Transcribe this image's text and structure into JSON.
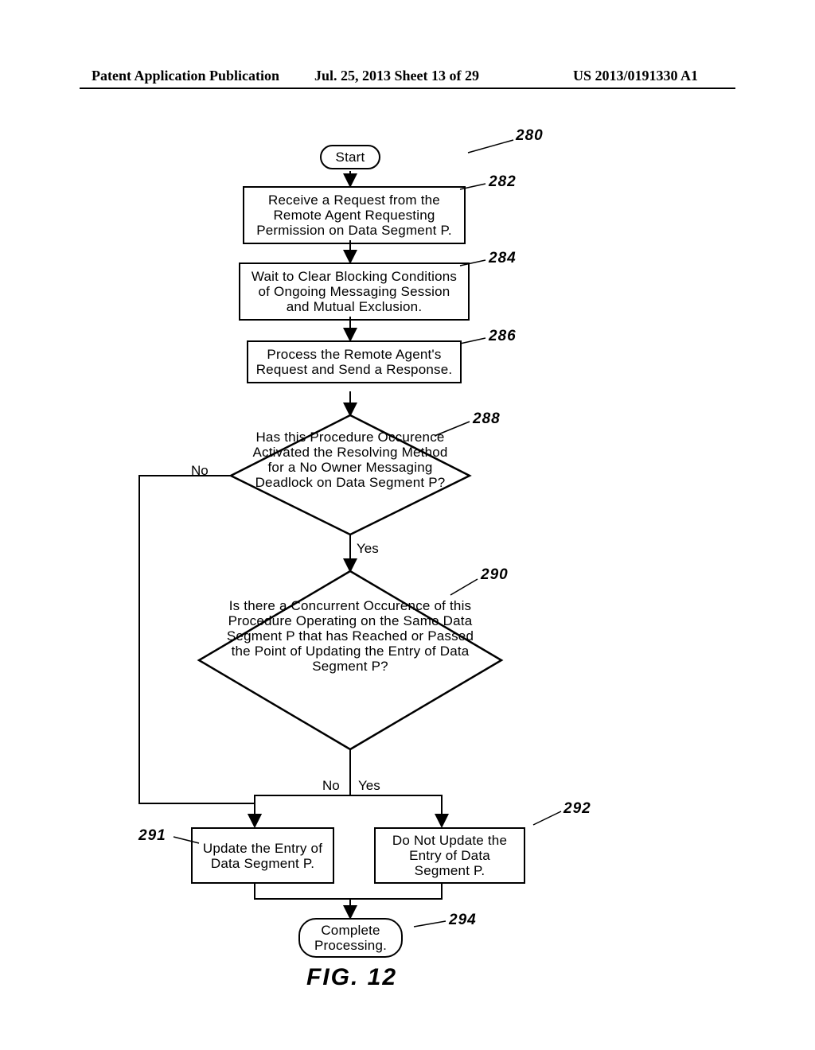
{
  "header": {
    "left": "Patent Application Publication",
    "mid": "Jul. 25, 2013  Sheet 13 of 29",
    "right": "US 2013/0191330 A1"
  },
  "figure": {
    "label": "FIG.  12",
    "refnums": {
      "n280": "280",
      "n282": "282",
      "n284": "284",
      "n286": "286",
      "n288": "288",
      "n290": "290",
      "n291": "291",
      "n292": "292",
      "n294": "294"
    },
    "nodes": {
      "start": "Start",
      "b282": "Receive a Request from the Remote Agent Requesting Permission on Data Segment P.",
      "b284": "Wait to Clear Blocking Conditions of Ongoing Messaging Session and Mutual Exclusion.",
      "b286": "Process the Remote Agent's Request and Send a Response.",
      "d288": "Has this Procedure Occurence Activated the Resolving Method for a No Owner Messaging Deadlock on Data Segment P?",
      "d290": "Is there a Concurrent Occurence of this Procedure Operating on the Same Data Segment P that has Reached or Passed the Point of Updating the Entry of Data Segment P?",
      "b291": "Update the Entry of Data Segment P.",
      "b292": "Do Not Update the Entry of Data Segment P.",
      "end": "Complete Processing."
    },
    "edges": {
      "d288_no": "No",
      "d288_yes": "Yes",
      "d290_no": "No",
      "d290_yes": "Yes"
    }
  }
}
